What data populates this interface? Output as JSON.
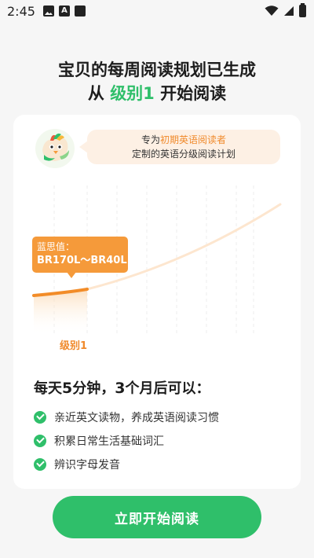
{
  "status_bar": {
    "time": "2:45"
  },
  "headline": {
    "line1": "宝贝的每周阅读规划已生成",
    "line2_prefix": "从 ",
    "line2_level": "级别1",
    "line2_suffix": " 开始阅读"
  },
  "bubble": {
    "prefix": "专为",
    "highlight": "初期英语阅读者",
    "line2": "定制的英语分级阅读计划"
  },
  "chart": {
    "tooltip_label": "蓝思值：",
    "tooltip_range": "BR170L～BR40L",
    "x_label": "级别1"
  },
  "chart_data": {
    "type": "line",
    "title": "",
    "xlabel": "",
    "ylabel": "",
    "series": [
      {
        "highlighted_segment_label": "级别1",
        "range": "BR170L～BR40L"
      }
    ]
  },
  "benefits": {
    "title_a": "每天",
    "title_b": "5",
    "title_c": "分钟，",
    "title_d": "3",
    "title_e": "个月后可以：",
    "items": [
      "亲近英文读物，养成英语阅读习惯",
      "积累日常生活基础词汇",
      "辨识字母发音"
    ]
  },
  "cta": {
    "label": "立即开始阅读"
  },
  "colors": {
    "accent": "#2fbf6a",
    "orange": "#f59a3a",
    "bubble": "#fdf0e4"
  }
}
